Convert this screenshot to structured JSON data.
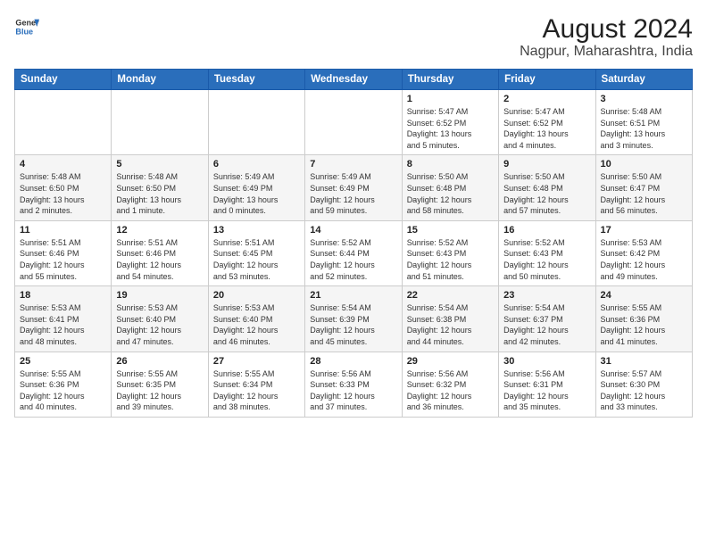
{
  "header": {
    "logo_line1": "General",
    "logo_line2": "Blue",
    "title": "August 2024",
    "subtitle": "Nagpur, Maharashtra, India"
  },
  "calendar": {
    "weekdays": [
      "Sunday",
      "Monday",
      "Tuesday",
      "Wednesday",
      "Thursday",
      "Friday",
      "Saturday"
    ],
    "weeks": [
      [
        {
          "day": "",
          "info": ""
        },
        {
          "day": "",
          "info": ""
        },
        {
          "day": "",
          "info": ""
        },
        {
          "day": "",
          "info": ""
        },
        {
          "day": "1",
          "info": "Sunrise: 5:47 AM\nSunset: 6:52 PM\nDaylight: 13 hours\nand 5 minutes."
        },
        {
          "day": "2",
          "info": "Sunrise: 5:47 AM\nSunset: 6:52 PM\nDaylight: 13 hours\nand 4 minutes."
        },
        {
          "day": "3",
          "info": "Sunrise: 5:48 AM\nSunset: 6:51 PM\nDaylight: 13 hours\nand 3 minutes."
        }
      ],
      [
        {
          "day": "4",
          "info": "Sunrise: 5:48 AM\nSunset: 6:50 PM\nDaylight: 13 hours\nand 2 minutes."
        },
        {
          "day": "5",
          "info": "Sunrise: 5:48 AM\nSunset: 6:50 PM\nDaylight: 13 hours\nand 1 minute."
        },
        {
          "day": "6",
          "info": "Sunrise: 5:49 AM\nSunset: 6:49 PM\nDaylight: 13 hours\nand 0 minutes."
        },
        {
          "day": "7",
          "info": "Sunrise: 5:49 AM\nSunset: 6:49 PM\nDaylight: 12 hours\nand 59 minutes."
        },
        {
          "day": "8",
          "info": "Sunrise: 5:50 AM\nSunset: 6:48 PM\nDaylight: 12 hours\nand 58 minutes."
        },
        {
          "day": "9",
          "info": "Sunrise: 5:50 AM\nSunset: 6:48 PM\nDaylight: 12 hours\nand 57 minutes."
        },
        {
          "day": "10",
          "info": "Sunrise: 5:50 AM\nSunset: 6:47 PM\nDaylight: 12 hours\nand 56 minutes."
        }
      ],
      [
        {
          "day": "11",
          "info": "Sunrise: 5:51 AM\nSunset: 6:46 PM\nDaylight: 12 hours\nand 55 minutes."
        },
        {
          "day": "12",
          "info": "Sunrise: 5:51 AM\nSunset: 6:46 PM\nDaylight: 12 hours\nand 54 minutes."
        },
        {
          "day": "13",
          "info": "Sunrise: 5:51 AM\nSunset: 6:45 PM\nDaylight: 12 hours\nand 53 minutes."
        },
        {
          "day": "14",
          "info": "Sunrise: 5:52 AM\nSunset: 6:44 PM\nDaylight: 12 hours\nand 52 minutes."
        },
        {
          "day": "15",
          "info": "Sunrise: 5:52 AM\nSunset: 6:43 PM\nDaylight: 12 hours\nand 51 minutes."
        },
        {
          "day": "16",
          "info": "Sunrise: 5:52 AM\nSunset: 6:43 PM\nDaylight: 12 hours\nand 50 minutes."
        },
        {
          "day": "17",
          "info": "Sunrise: 5:53 AM\nSunset: 6:42 PM\nDaylight: 12 hours\nand 49 minutes."
        }
      ],
      [
        {
          "day": "18",
          "info": "Sunrise: 5:53 AM\nSunset: 6:41 PM\nDaylight: 12 hours\nand 48 minutes."
        },
        {
          "day": "19",
          "info": "Sunrise: 5:53 AM\nSunset: 6:40 PM\nDaylight: 12 hours\nand 47 minutes."
        },
        {
          "day": "20",
          "info": "Sunrise: 5:53 AM\nSunset: 6:40 PM\nDaylight: 12 hours\nand 46 minutes."
        },
        {
          "day": "21",
          "info": "Sunrise: 5:54 AM\nSunset: 6:39 PM\nDaylight: 12 hours\nand 45 minutes."
        },
        {
          "day": "22",
          "info": "Sunrise: 5:54 AM\nSunset: 6:38 PM\nDaylight: 12 hours\nand 44 minutes."
        },
        {
          "day": "23",
          "info": "Sunrise: 5:54 AM\nSunset: 6:37 PM\nDaylight: 12 hours\nand 42 minutes."
        },
        {
          "day": "24",
          "info": "Sunrise: 5:55 AM\nSunset: 6:36 PM\nDaylight: 12 hours\nand 41 minutes."
        }
      ],
      [
        {
          "day": "25",
          "info": "Sunrise: 5:55 AM\nSunset: 6:36 PM\nDaylight: 12 hours\nand 40 minutes."
        },
        {
          "day": "26",
          "info": "Sunrise: 5:55 AM\nSunset: 6:35 PM\nDaylight: 12 hours\nand 39 minutes."
        },
        {
          "day": "27",
          "info": "Sunrise: 5:55 AM\nSunset: 6:34 PM\nDaylight: 12 hours\nand 38 minutes."
        },
        {
          "day": "28",
          "info": "Sunrise: 5:56 AM\nSunset: 6:33 PM\nDaylight: 12 hours\nand 37 minutes."
        },
        {
          "day": "29",
          "info": "Sunrise: 5:56 AM\nSunset: 6:32 PM\nDaylight: 12 hours\nand 36 minutes."
        },
        {
          "day": "30",
          "info": "Sunrise: 5:56 AM\nSunset: 6:31 PM\nDaylight: 12 hours\nand 35 minutes."
        },
        {
          "day": "31",
          "info": "Sunrise: 5:57 AM\nSunset: 6:30 PM\nDaylight: 12 hours\nand 33 minutes."
        }
      ]
    ]
  }
}
